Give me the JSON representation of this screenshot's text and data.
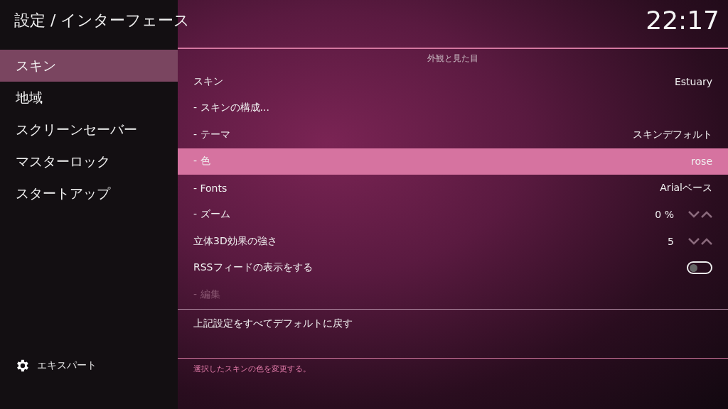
{
  "header": {
    "title": "設定 / インターフェース",
    "clock": "22:17"
  },
  "sidebar": {
    "items": [
      {
        "label": "スキン",
        "selected": true
      },
      {
        "label": "地域",
        "selected": false
      },
      {
        "label": "スクリーンセーバー",
        "selected": false
      },
      {
        "label": "マスターロック",
        "selected": false
      },
      {
        "label": "スタートアップ",
        "selected": false
      }
    ],
    "level_button": {
      "label": "エキスパート"
    }
  },
  "section_title": "外観と見た目",
  "settings": [
    {
      "kind": "value",
      "label": "スキン",
      "value": "Estuary",
      "selected": false,
      "disabled": false
    },
    {
      "kind": "action",
      "label": "- スキンの構成...",
      "selected": false,
      "disabled": false
    },
    {
      "kind": "value",
      "label": "- テーマ",
      "value": "スキンデフォルト",
      "selected": false,
      "disabled": false
    },
    {
      "kind": "value",
      "label": "- 色",
      "value": "rose",
      "selected": true,
      "disabled": false
    },
    {
      "kind": "value",
      "label": "- Fonts",
      "value": "Arialベース",
      "selected": false,
      "disabled": false
    },
    {
      "kind": "spinner",
      "label": "- ズーム",
      "value": "0 %",
      "selected": false,
      "disabled": false
    },
    {
      "kind": "spinner",
      "label": "立体3D効果の強さ",
      "value": "5",
      "selected": false,
      "disabled": false
    },
    {
      "kind": "toggle",
      "label": "RSSフィードの表示をする",
      "on": false,
      "selected": false,
      "disabled": false
    },
    {
      "kind": "action",
      "label": "- 編集",
      "selected": false,
      "disabled": true
    }
  ],
  "reset": {
    "label": "上記設定をすべてデフォルトに戻す"
  },
  "description": "選択したスキンの色を変更する。"
}
